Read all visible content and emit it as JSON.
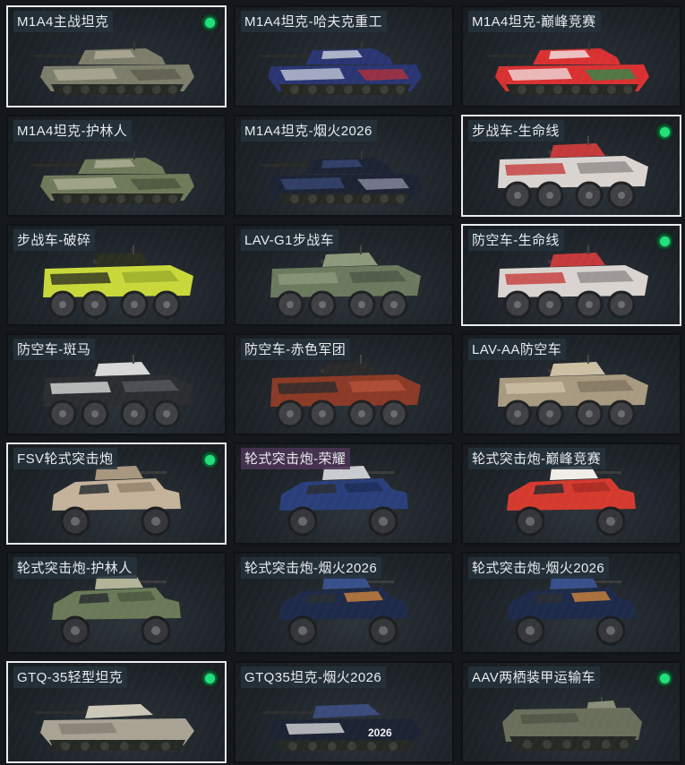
{
  "colors": {
    "selected_border": "#e9ecef",
    "owned_indicator": "#22e07a",
    "label_bg": "#26323c",
    "label_bg_special": "#4a3454"
  },
  "skins": [
    {
      "label": "M1A4主战坦克",
      "type": "tank",
      "camo": [
        "#7d7d6c",
        "#b7b29c",
        "#5b5c4e"
      ],
      "selected": true,
      "owned": true
    },
    {
      "label": "M1A4坦克-哈夫克重工",
      "type": "tank",
      "camo": [
        "#2a3572",
        "#d8dce6",
        "#b23139"
      ],
      "selected": false,
      "owned": false
    },
    {
      "label": "M1A4坦克-巅峰竞赛",
      "type": "tank",
      "camo": [
        "#d93131",
        "#f2f2f2",
        "#2f8a4a"
      ],
      "selected": false,
      "owned": false
    },
    {
      "label": "M1A4坦克-护林人",
      "type": "tank",
      "camo": [
        "#6f7a5a",
        "#b3b59a",
        "#4b553f"
      ],
      "selected": false,
      "owned": false
    },
    {
      "label": "M1A4坦克-烟火2026",
      "type": "tank",
      "camo": [
        "#1c2333",
        "#3a4a7a",
        "#8a8aa0"
      ],
      "selected": false,
      "owned": false
    },
    {
      "label": "步战车-生命线",
      "type": "ifv",
      "camo": [
        "#d9d4d0",
        "#c43a3a",
        "#8e8a88"
      ],
      "selected": true,
      "owned": true
    },
    {
      "label": "步战车-破碎",
      "type": "ifv",
      "camo": [
        "#c8d83a",
        "#2a2f22",
        "#9aab2a"
      ],
      "selected": false,
      "owned": false
    },
    {
      "label": "LAV-G1步战车",
      "type": "ifv",
      "camo": [
        "#6b7a5e",
        "#8b987a",
        "#4c5844"
      ],
      "selected": false,
      "owned": false
    },
    {
      "label": "防空车-生命线",
      "type": "ifv",
      "camo": [
        "#d9d4d0",
        "#c43a3a",
        "#8e8a88"
      ],
      "selected": true,
      "owned": true
    },
    {
      "label": "防空车-斑马",
      "type": "ifv",
      "camo": [
        "#2b2d30",
        "#d8d8d8",
        "#55585c"
      ],
      "selected": false,
      "owned": false
    },
    {
      "label": "防空车-赤色军团",
      "type": "ifv",
      "camo": [
        "#8a3a26",
        "#2a2a2a",
        "#b5533a"
      ],
      "selected": false,
      "owned": false
    },
    {
      "label": "LAV-AA防空车",
      "type": "ifv",
      "camo": [
        "#a89a80",
        "#cdbfa4",
        "#7f7460"
      ],
      "selected": false,
      "owned": false
    },
    {
      "label": "FSV轮式突击炮",
      "type": "fsv",
      "camo": [
        "#c4b29a",
        "#a8967e",
        "#8d7c66"
      ],
      "selected": true,
      "owned": true
    },
    {
      "label": "轮式突击炮-荣耀",
      "type": "fsv",
      "camo": [
        "#2a3f7a",
        "#c9cbd0",
        "#1c2b55"
      ],
      "selected": false,
      "owned": false,
      "special": true
    },
    {
      "label": "轮式突击炮-巅峰竞赛",
      "type": "fsv",
      "camo": [
        "#d53a2e",
        "#f0ece8",
        "#a32a22"
      ],
      "selected": false,
      "owned": false
    },
    {
      "label": "轮式突击炮-护林人",
      "type": "fsv",
      "camo": [
        "#6a7a58",
        "#b2b498",
        "#4a563e"
      ],
      "selected": false,
      "owned": false
    },
    {
      "label": "轮式突击炮-烟火2026",
      "type": "fsv",
      "camo": [
        "#1d2a4a",
        "#38508a",
        "#d98a3a"
      ],
      "selected": false,
      "owned": false
    },
    {
      "label": "轮式突击炮-烟火2026",
      "type": "fsv",
      "camo": [
        "#1d2a4a",
        "#38508a",
        "#d98a3a"
      ],
      "selected": false,
      "owned": false
    },
    {
      "label": "GTQ-35轻型坦克",
      "type": "light",
      "camo": [
        "#a9a394",
        "#cbc6b8",
        "#7d786c"
      ],
      "selected": true,
      "owned": true
    },
    {
      "label": "GTQ35坦克-烟火2026",
      "type": "light",
      "camo": [
        "#1c2333",
        "#3a4a7a",
        "#f0f0f0"
      ],
      "selected": false,
      "owned": false,
      "decal": "2026"
    },
    {
      "label": "AAV两栖装甲运输车",
      "type": "aav",
      "camo": [
        "#6a6f5c",
        "#8a8e78",
        "#4e5344"
      ],
      "selected": false,
      "owned": true
    }
  ]
}
